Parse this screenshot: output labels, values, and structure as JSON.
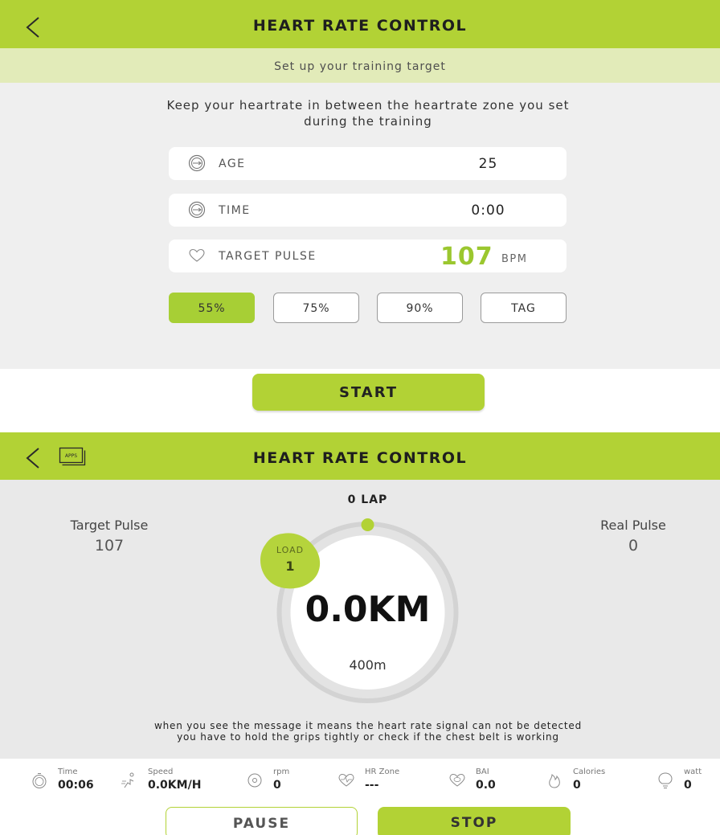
{
  "setup": {
    "title": "HEART RATE CONTROL",
    "subtitle": "Set up your training target",
    "description": "Keep your heartrate in between the heartrate zone you set during the training",
    "age": {
      "icon": "dial-icon",
      "label": "AGE",
      "value": "25"
    },
    "time": {
      "icon": "dial-icon",
      "label": "TIME",
      "value": "0:00"
    },
    "target_pulse": {
      "icon": "heart-icon",
      "label": "TARGET PULSE",
      "value": "107",
      "unit": "BPM"
    },
    "zones": [
      "55%",
      "75%",
      "90%",
      "TAG"
    ],
    "selected_zone": "55%",
    "start_label": "START"
  },
  "workout": {
    "title": "HEART RATE CONTROL",
    "apps_label": "APPS",
    "lap": "0 LAP",
    "target_pulse_label": "Target Pulse",
    "target_pulse_value": "107",
    "real_pulse_label": "Real Pulse",
    "real_pulse_value": "0",
    "load_label": "LOAD",
    "load_value": "1",
    "distance": "0.0KM",
    "lap_length": "400m",
    "message_line1": "when you see the message it means the heart rate signal can not be detected",
    "message_line2": "you have to hold the grips tightly or check if the chest belt is working",
    "stats": [
      {
        "icon": "stopwatch-icon",
        "label": "Time",
        "value": "00:06"
      },
      {
        "icon": "runner-icon",
        "label": "Speed",
        "value": "0.0KM/H"
      },
      {
        "icon": "rpm-icon",
        "label": "rpm",
        "value": "0"
      },
      {
        "icon": "heart-pulse-icon",
        "label": "HR Zone",
        "value": "---"
      },
      {
        "icon": "bai-heart-icon",
        "label": "BAI",
        "value": "0.0"
      },
      {
        "icon": "flame-icon",
        "label": "Calories",
        "value": "0"
      },
      {
        "icon": "bulb-icon",
        "label": "watt",
        "value": "0"
      }
    ],
    "pause_label": "PAUSE",
    "stop_label": "STOP"
  },
  "colors": {
    "accent": "#b2d235",
    "accent_light": "#e2ebb9",
    "panel": "#efefef",
    "pulse_green": "#9bc72f"
  }
}
